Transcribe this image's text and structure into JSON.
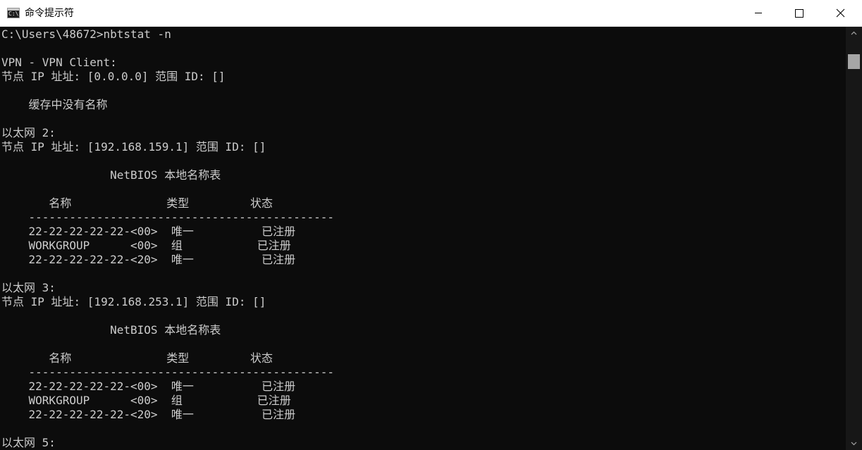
{
  "window": {
    "title": "命令提示符",
    "app_icon_text": "C:\\",
    "icon_names": {
      "app": "command-prompt-icon",
      "minimize": "minimize-icon",
      "maximize": "maximize-icon",
      "close": "close-icon"
    }
  },
  "colors": {
    "titlebar_bg": "#ffffff",
    "console_bg": "#0c0c0c",
    "console_text": "#cccccc",
    "scrollbar_bg": "#171717",
    "scroll_thumb": "#a6a6a6"
  },
  "console": {
    "lines": [
      "C:\\Users\\48672>nbtstat -n",
      "",
      "VPN - VPN Client:",
      "节点 IP 址址: [0.0.0.0] 范围 ID: []",
      "",
      "    缓存中没有名称",
      "",
      "以太网 2:",
      "节点 IP 址址: [192.168.159.1] 范围 ID: []",
      "",
      "                NetBIOS 本地名称表",
      "",
      "       名称              类型         状态",
      "    ---------------------------------------------",
      "    22-22-22-22-22-<00>  唯一          已注册",
      "    WORKGROUP      <00>  组           已注册",
      "    22-22-22-22-22-<20>  唯一          已注册",
      "",
      "以太网 3:",
      "节点 IP 址址: [192.168.253.1] 范围 ID: []",
      "",
      "                NetBIOS 本地名称表",
      "",
      "       名称              类型         状态",
      "    ---------------------------------------------",
      "    22-22-22-22-22-<00>  唯一          已注册",
      "    WORKGROUP      <00>  组           已注册",
      "    22-22-22-22-22-<20>  唯一          已注册",
      "",
      "以太网 5:"
    ]
  }
}
